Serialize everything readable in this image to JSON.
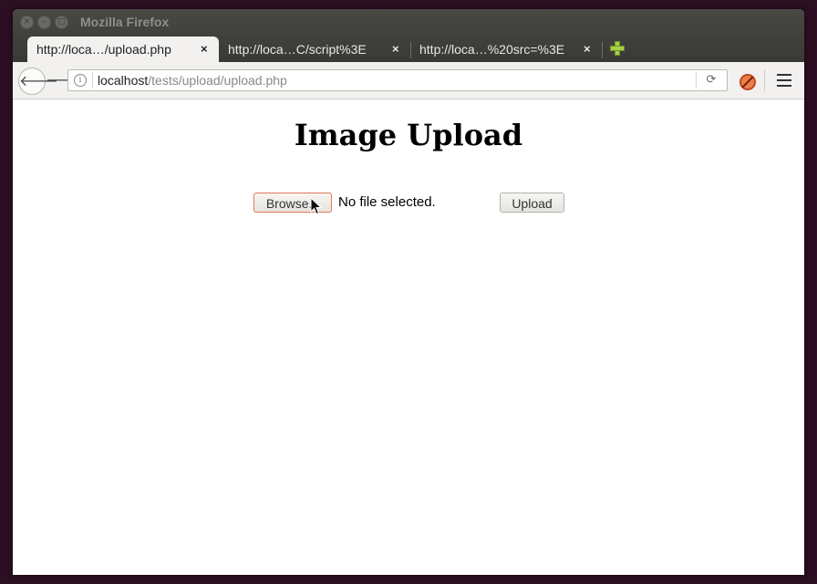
{
  "window": {
    "title": "Mozilla Firefox",
    "close_glyph": "×",
    "minimize_glyph": "–",
    "maximize_glyph": "□"
  },
  "tabs": [
    {
      "label": "http://loca…/upload.php",
      "close": "×",
      "active": true
    },
    {
      "label": "http://loca…C/script%3E",
      "close": "×",
      "active": false
    },
    {
      "label": "http://loca…%20src=%3E",
      "close": "×",
      "active": false
    }
  ],
  "toolbar": {
    "back_glyph": "🡐",
    "forward_glyph": "🡒",
    "info_glyph": "i",
    "reload_glyph": "⟳",
    "url_host": "localhost",
    "url_path": "/tests/upload/upload.php"
  },
  "icons": {
    "new_tab": "plus-icon",
    "addon": "blocked-addon-icon",
    "menu": "hamburger-menu-icon",
    "cursor": "mouse-pointer-icon"
  },
  "page": {
    "title": "Image Upload",
    "browse_label": "Browse...",
    "file_status": "No file selected.",
    "upload_label": "Upload"
  },
  "colors": {
    "desktop_bg": "#2c0f22",
    "chrome_dark": "#3a3935",
    "new_tab_green": "#a6cf47",
    "browse_focus_border": "#e07b59"
  }
}
